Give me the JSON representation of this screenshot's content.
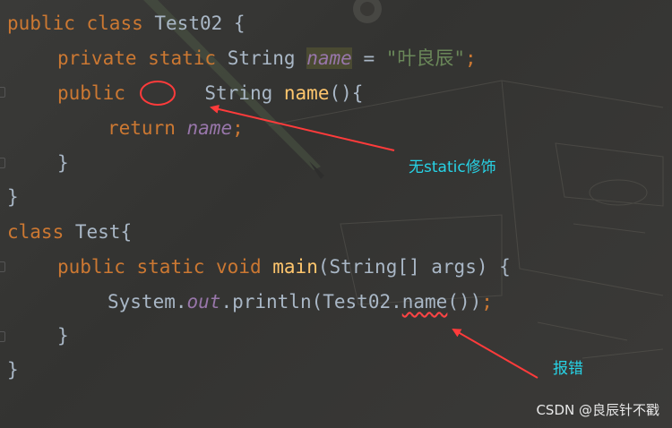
{
  "code": {
    "line1": {
      "kw1": "public",
      "kw2": "class",
      "name": "Test02",
      "brace": "{"
    },
    "line2": {
      "kw1": "private",
      "kw2": "static",
      "type": "String",
      "field": "name",
      "eq": "=",
      "str": "\"叶良辰\"",
      "semi": ";"
    },
    "line3": {
      "kw1": "public",
      "type": "String",
      "method": "name",
      "rest": "(){"
    },
    "line4": {
      "kw": "return",
      "field": "name",
      "semi": ";"
    },
    "line5": {
      "text": "}"
    },
    "line6": {
      "text": "}"
    },
    "line7": {
      "kw": "class",
      "name": "Test{"
    },
    "line8": {
      "kw1": "public",
      "kw2": "static",
      "kw3": "void",
      "method": "main",
      "rest": "(String[] args) {"
    },
    "line9": {
      "pre": "System.",
      "field": "out",
      "mid": ".println(Test02.",
      "err": "name",
      "post": "())",
      "semi": ";"
    },
    "line10": {
      "text": "}"
    },
    "line11": {
      "text": "}"
    }
  },
  "annotations": {
    "missing_static": "无static修饰",
    "error": "报错"
  },
  "watermark": "CSDN @良辰针不戳",
  "colors": {
    "keyword": "#cc7832",
    "string": "#6a8759",
    "field": "#9876aa",
    "method": "#ffc66d",
    "annotation_text": "#27d3e6",
    "annotation_arrow": "#ff3b3b"
  }
}
